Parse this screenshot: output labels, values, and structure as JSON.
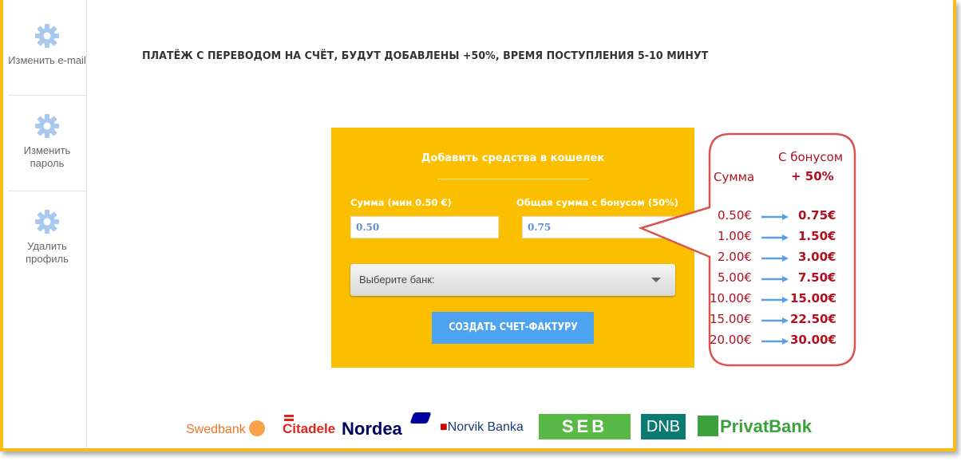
{
  "sidebar": {
    "items": [
      {
        "label": "Изменить e-mail",
        "icon": "gear-icon"
      },
      {
        "label": "Изменить пароль",
        "icon": "gear-icon"
      },
      {
        "label": "Удалить профиль",
        "icon": "gear-icon"
      }
    ]
  },
  "heading": "ПЛАТЁЖ С ПЕРЕВОДОМ НА СЧЁТ, БУДУТ ДОБАВЛЕНЫ +50%, ВРЕМЯ ПОСТУПЛЕНИЯ 5-10 МИНУТ",
  "panel": {
    "title": "Добавить средства в кошелек",
    "amount_label": "Сумма (мин 0.50 €)",
    "amount_value": "0.50",
    "total_label": "Общая сумма с бонусом (50%)",
    "total_value": "0.75",
    "bank_select": "Выберите банк:",
    "submit_label": "СОЗДАТЬ СЧЕТ-ФАКТУРУ"
  },
  "callout": {
    "col_sum": "Сумма",
    "col_bonus_line1": "С бонусом",
    "col_bonus_line2": "+ 50%",
    "rows": [
      {
        "sum": "0.50€",
        "bonus": "0.75€"
      },
      {
        "sum": "1.00€",
        "bonus": "1.50€"
      },
      {
        "sum": "2.00€",
        "bonus": "3.00€"
      },
      {
        "sum": "5.00€",
        "bonus": "7.50€"
      },
      {
        "sum": "10.00€",
        "bonus": "15.00€"
      },
      {
        "sum": "15.00€",
        "bonus": "22.50€"
      },
      {
        "sum": "20.00€",
        "bonus": "30.00€"
      }
    ]
  },
  "banks": [
    "Swedbank",
    "Citadele",
    "Nordea",
    "Norvik Banka",
    "SEB",
    "DNB",
    "PrivatBank"
  ],
  "colors": {
    "accent": "#fbbf00",
    "button": "#4ea3f1",
    "callout_border": "#d9534f",
    "callout_text": "#b01020"
  }
}
